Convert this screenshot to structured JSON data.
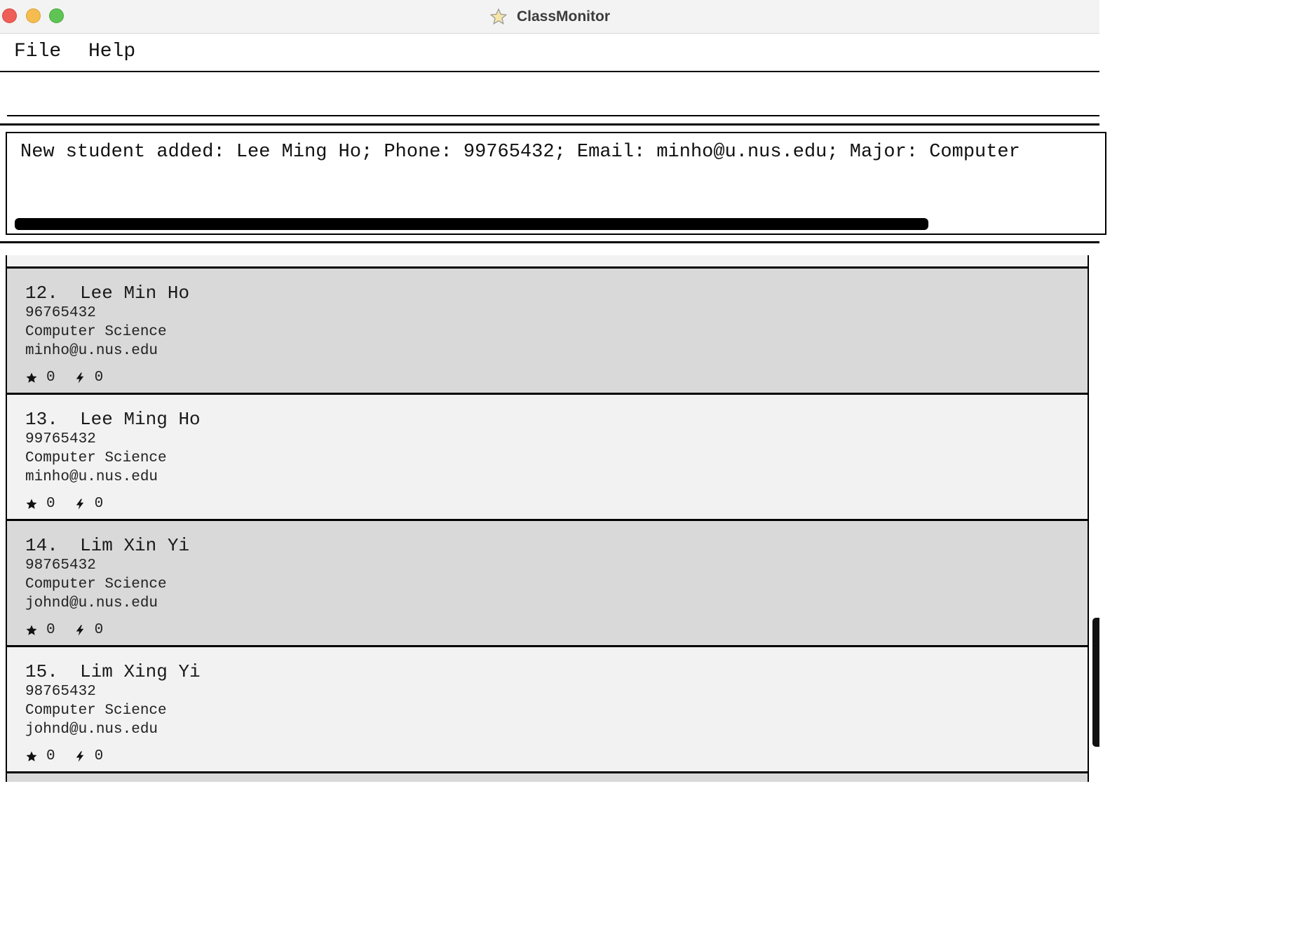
{
  "window": {
    "title": "ClassMonitor",
    "app_icon": "star-icon"
  },
  "menu": {
    "items": [
      {
        "label": "File"
      },
      {
        "label": "Help"
      }
    ]
  },
  "command": {
    "value": "",
    "placeholder": ""
  },
  "result": {
    "text": "New student added: Lee Ming Ho; Phone: 99765432; Email: minho@u.nus.edu; Major: Computer"
  },
  "students": [
    {
      "index": "12.",
      "name": "Lee Min Ho",
      "phone": "96765432",
      "major": "Computer Science",
      "email": "minho@u.nus.edu",
      "stars": "0",
      "flags": "0"
    },
    {
      "index": "13.",
      "name": "Lee Ming Ho",
      "phone": "99765432",
      "major": "Computer Science",
      "email": "minho@u.nus.edu",
      "stars": "0",
      "flags": "0"
    },
    {
      "index": "14.",
      "name": "Lim Xin Yi",
      "phone": "98765432",
      "major": "Computer Science",
      "email": "johnd@u.nus.edu",
      "stars": "0",
      "flags": "0"
    },
    {
      "index": "15.",
      "name": "Lim Xing Yi",
      "phone": "98765432",
      "major": "Computer Science",
      "email": "johnd@u.nus.edu",
      "stars": "0",
      "flags": "0"
    }
  ],
  "icons": {
    "star": "star-icon",
    "flag": "lightning-icon"
  }
}
